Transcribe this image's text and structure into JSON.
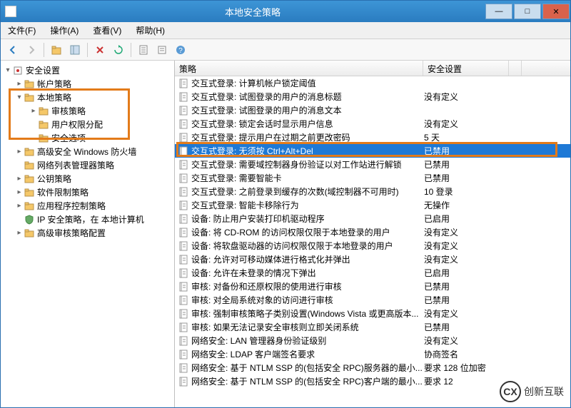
{
  "window": {
    "title": "本地安全策略"
  },
  "menu": {
    "file": "文件(F)",
    "action": "操作(A)",
    "view": "查看(V)",
    "help": "帮助(H)"
  },
  "toolbar_icons": [
    "back",
    "forward",
    "up",
    "show-hide-tree",
    "export",
    "delete",
    "refresh",
    "properties",
    "help"
  ],
  "tree": {
    "root": "安全设置",
    "items": [
      {
        "label": "帐户策略",
        "level": 1,
        "expandable": true
      },
      {
        "label": "本地策略",
        "level": 1,
        "expandable": true,
        "expanded": true,
        "highlight": true
      },
      {
        "label": "审核策略",
        "level": 2,
        "expandable": true
      },
      {
        "label": "用户权限分配",
        "level": 2,
        "expandable": false
      },
      {
        "label": "安全选项",
        "level": 2,
        "expandable": false
      },
      {
        "label": "高级安全 Windows 防火墙",
        "level": 1,
        "expandable": true
      },
      {
        "label": "网络列表管理器策略",
        "level": 1,
        "expandable": false
      },
      {
        "label": "公钥策略",
        "level": 1,
        "expandable": true
      },
      {
        "label": "软件限制策略",
        "level": 1,
        "expandable": true
      },
      {
        "label": "应用程序控制策略",
        "level": 1,
        "expandable": true
      },
      {
        "label": "IP 安全策略，在 本地计算机",
        "level": 1,
        "expandable": false,
        "icon": "shield"
      },
      {
        "label": "高级审核策略配置",
        "level": 1,
        "expandable": true
      }
    ]
  },
  "columns": {
    "policy": "策略",
    "setting": "安全设置"
  },
  "rows": [
    {
      "policy": "交互式登录: 计算机帐户锁定阈值",
      "setting": ""
    },
    {
      "policy": "交互式登录: 试图登录的用户的消息标题",
      "setting": "没有定义"
    },
    {
      "policy": "交互式登录: 试图登录的用户的消息文本",
      "setting": ""
    },
    {
      "policy": "交互式登录: 锁定会话时显示用户信息",
      "setting": "没有定义"
    },
    {
      "policy": "交互式登录: 提示用户在过期之前更改密码",
      "setting": "5 天"
    },
    {
      "policy": "交互式登录: 无须按 Ctrl+Alt+Del",
      "setting": "已禁用",
      "selected": true,
      "highlight": true
    },
    {
      "policy": "交互式登录: 需要域控制器身份验证以对工作站进行解锁",
      "setting": "已禁用"
    },
    {
      "policy": "交互式登录: 需要智能卡",
      "setting": "已禁用"
    },
    {
      "policy": "交互式登录: 之前登录到缓存的次数(域控制器不可用时)",
      "setting": "10 登录"
    },
    {
      "policy": "交互式登录: 智能卡移除行为",
      "setting": "无操作"
    },
    {
      "policy": "设备: 防止用户安装打印机驱动程序",
      "setting": "已启用"
    },
    {
      "policy": "设备: 将 CD-ROM 的访问权限仅限于本地登录的用户",
      "setting": "没有定义"
    },
    {
      "policy": "设备: 将软盘驱动器的访问权限仅限于本地登录的用户",
      "setting": "没有定义"
    },
    {
      "policy": "设备: 允许对可移动媒体进行格式化并弹出",
      "setting": "没有定义"
    },
    {
      "policy": "设备: 允许在未登录的情况下弹出",
      "setting": "已启用"
    },
    {
      "policy": "审核: 对备份和还原权限的使用进行审核",
      "setting": "已禁用"
    },
    {
      "policy": "审核: 对全局系统对象的访问进行审核",
      "setting": "已禁用"
    },
    {
      "policy": "审核: 强制审核策略子类别设置(Windows Vista 或更高版本...",
      "setting": "没有定义"
    },
    {
      "policy": "审核: 如果无法记录安全审核则立即关闭系统",
      "setting": "已禁用"
    },
    {
      "policy": "网络安全: LAN 管理器身份验证级别",
      "setting": "没有定义"
    },
    {
      "policy": "网络安全: LDAP 客户端签名要求",
      "setting": "协商签名"
    },
    {
      "policy": "网络安全: 基于 NTLM SSP 的(包括安全 RPC)服务器的最小...",
      "setting": "要求 128 位加密"
    },
    {
      "policy": "网络安全: 基于 NTLM SSP 的(包括安全 RPC)客户端的最小...",
      "setting": "要求 12"
    }
  ],
  "watermark": {
    "logo": "CX",
    "text": "创新互联"
  }
}
